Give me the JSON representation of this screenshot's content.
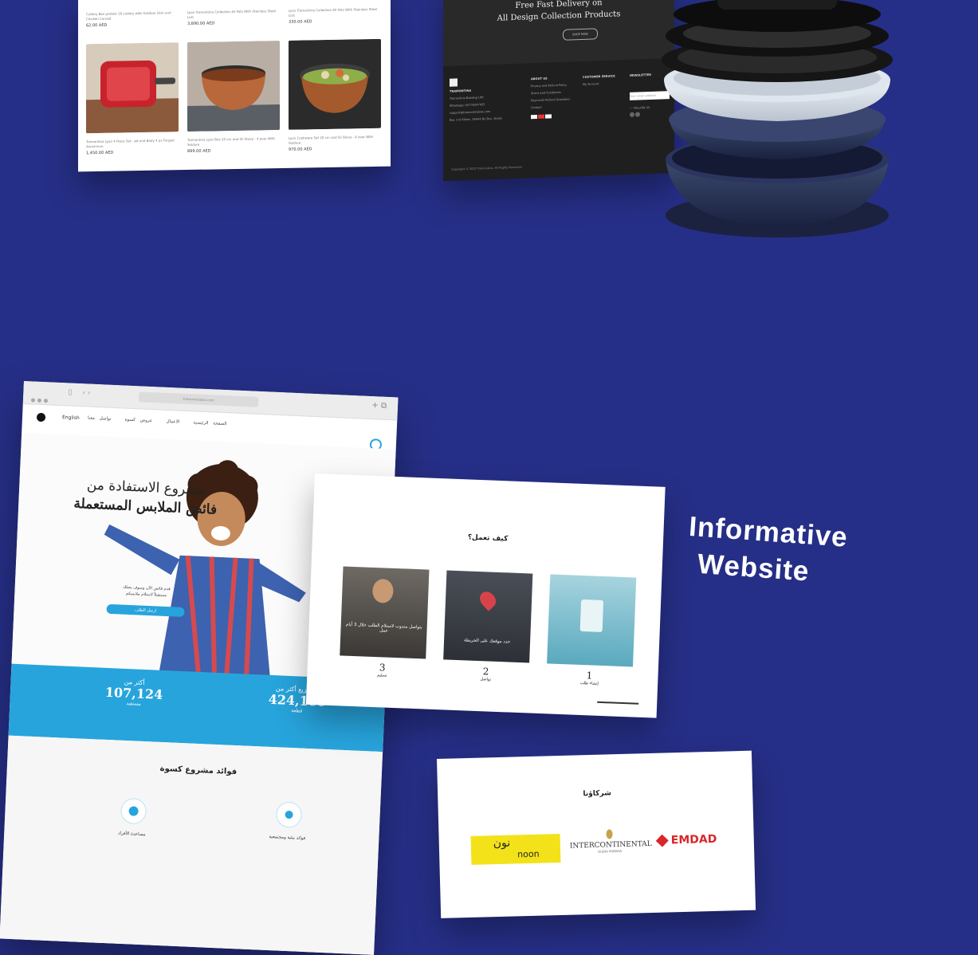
{
  "headline": {
    "line1": "Informative",
    "line2": "Website"
  },
  "shop": {
    "items": [
      {
        "caption": "Tramontina Lyon 4 Piece Set - Jet and Body 4 ps Forged Aluminium",
        "price": "1,450.00 AED"
      },
      {
        "caption": "Tramontina Lyon Box 20 cm and Sil Stove - 4 ever With Soldure",
        "price": "899.00 AED"
      },
      {
        "caption": "Lyon Cookware Set 20 cm and Sil Stove - 6 ever With Soldure",
        "price": "970.00 AED"
      }
    ],
    "top_prices": [
      "62.00 AED",
      "3,890.00 AED",
      "330.00 AED"
    ],
    "top_captions": [
      "Cutlery Box protect 16 cutlery with Outdoor Dish and Chicken Carved",
      "Lyon Tramontina Collection All Pots With Stainless Steel Lids",
      "Lyon Tramontina Collection All Pots With Stainless Steel Lids"
    ]
  },
  "footer": {
    "promo_line1": "Free Fast Delivery on",
    "promo_line2": "All Design Collection Products",
    "shop_button": "SHOP NOW",
    "brand": "TRAMONTINA",
    "contact": [
      "Tramontina Building UPC",
      "Whatsapp: 05776247455",
      "support@tramontinabox.com",
      "Box 3 of Khlasi, 3AAAF Bu Dec, Dubai"
    ],
    "about_title": "ABOUT US",
    "about_links": [
      "Privacy and Refund Policy",
      "Terms and Conditions",
      "Payments Refund Questions",
      "Contact"
    ],
    "service_title": "CUSTOMER SERVICE",
    "service_links": [
      "My Account"
    ],
    "newsletter_title": "NEWSLETTER",
    "newsletter_placeholder": "Your email address",
    "follow": "— FOLLOW US",
    "copyright": "Copyright © 2022 Tramontina. All Rights Reserved."
  },
  "browser": {
    "url": "tramontinabox.com",
    "lang": "English",
    "nav": [
      "الصفحة الرئيسية",
      "الاعمال",
      "عروض كسوة",
      "تواصل معنا"
    ],
    "hero_line1": "مشروع الاستفادة من",
    "hero_line2": "فائض الملابس المستعملة",
    "hero_sub1": "قدم فائض الآن وسوف يصلك",
    "hero_sub2": "مستقبلاً لاستلام ملابسكم",
    "hero_button": "ارسل الطلب",
    "stat_right_label": "تم توزيع أكثر من",
    "stat_right_value": "424,100",
    "stat_right_unit": "قطعة",
    "stat_left_label": "أكثر من",
    "stat_left_value": "107,124",
    "stat_left_unit": "مستفيد",
    "benefits_title": "فوائد مشروع كسوة",
    "benefit_right": "فوائد بيئية ومجتمعية",
    "benefit_left": "مساعدة الأفراد"
  },
  "how": {
    "title": "كيف تعمل؟",
    "steps": [
      {
        "num": "1",
        "label": "إنشاء طلب"
      },
      {
        "num": "2",
        "label": "تواصل"
      },
      {
        "num": "3",
        "label": "تسليم"
      }
    ],
    "card_text_2": "حدد موقعك على الخريطة",
    "card_text_3": "يتواصل مندوب لاستلام الطلب خلال 3 أيام عمل"
  },
  "partners": {
    "title": "شركاؤنا",
    "noon_ar": "نون",
    "noon_en": "noon",
    "inter": "INTERCONTINENTAL",
    "inter_sub": "DUBAI MARINA",
    "emdad": "EMDAD"
  },
  "colors": {
    "background": "#262f87",
    "accent": "#27a4dc",
    "noon_yellow": "#f3e219",
    "emdad_red": "#d8262a"
  }
}
